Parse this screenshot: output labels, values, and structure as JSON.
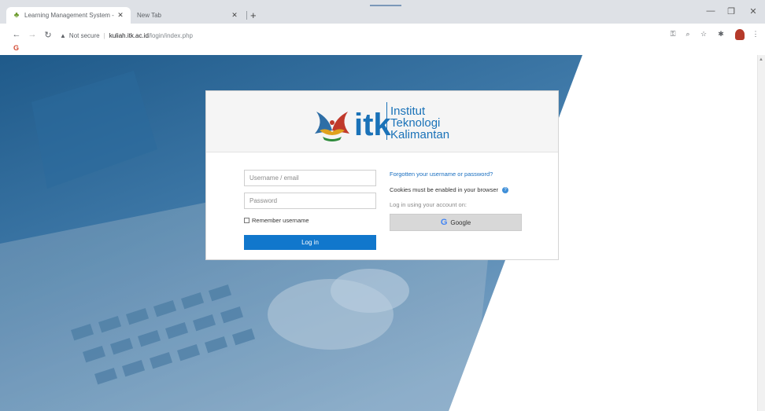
{
  "browser": {
    "tabs": [
      {
        "title": "Learning Management System -",
        "active": true
      },
      {
        "title": "New Tab",
        "active": false
      }
    ],
    "address": {
      "security_label": "Not secure",
      "host": "kuliah.itk.ac.id",
      "path": "/login/index.php"
    },
    "bookmark_icon": "G"
  },
  "login": {
    "institution": [
      "Institut",
      "Teknologi",
      "Kalimantan"
    ],
    "logo_letters": "itk",
    "username_placeholder": "Username / email",
    "password_placeholder": "Password",
    "remember_label": "Remember username",
    "login_button": "Log in",
    "forgot_link": "Forgotten your username or password?",
    "cookies_notice": "Cookies must be enabled in your browser",
    "help_icon": "?",
    "login_using": "Log in using your account on:",
    "google_button": "Google",
    "google_icon": "G"
  },
  "colors": {
    "primary": "#1177cc",
    "brand": "#1a72b8",
    "link": "#1a6fc0"
  }
}
